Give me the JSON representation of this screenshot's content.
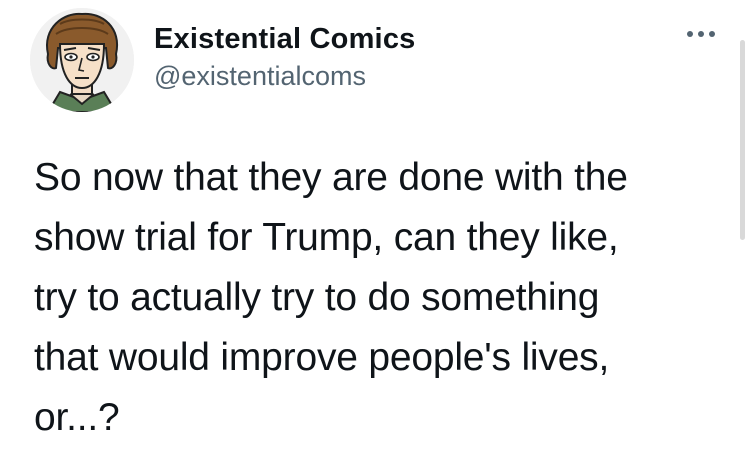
{
  "user": {
    "display_name": "Existential Comics",
    "handle": "@existentialcoms"
  },
  "icons": {
    "avatar": "cartoon-portrait-avatar",
    "more": "more-horizontal-icon"
  },
  "tweet": {
    "lines": [
      "So now that they are done with the",
      "show trial for Trump, can they like,",
      "try to actually try to do something",
      "that would improve people's lives,",
      "or...?"
    ]
  },
  "colors": {
    "text": "#0f1419",
    "secondary": "#536471"
  }
}
